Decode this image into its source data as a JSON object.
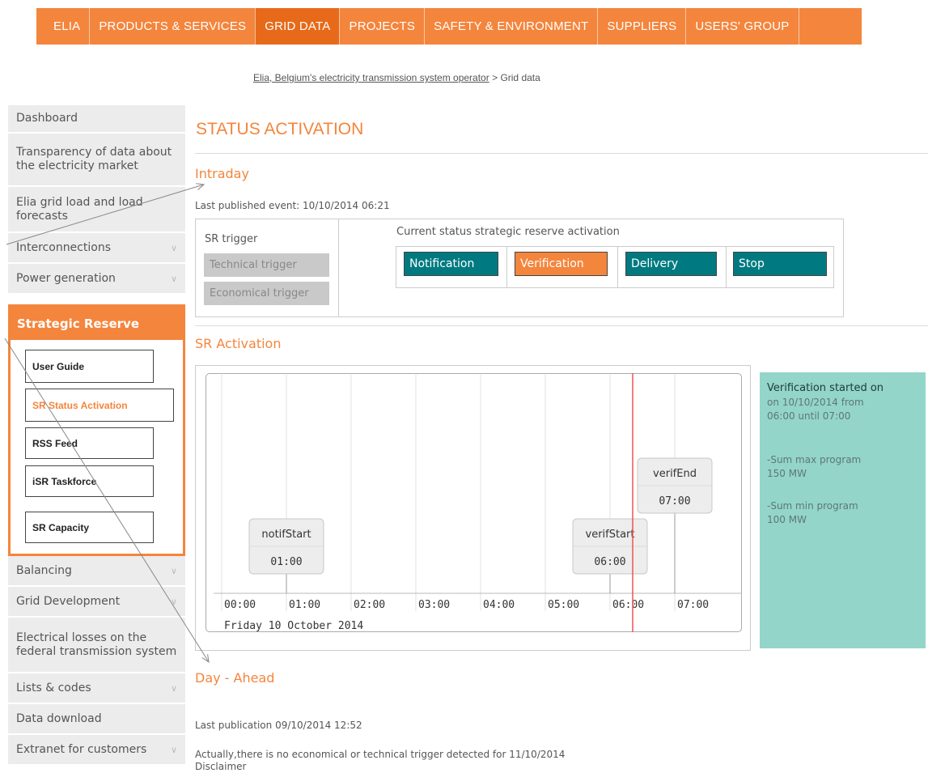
{
  "topnav": [
    "ELIA",
    "PRODUCTS & SERVICES",
    "GRID DATA",
    "PROJECTS",
    "SAFETY & ENVIRONMENT",
    "SUPPLIERS",
    "USERS' GROUP"
  ],
  "breadcrumb": {
    "link": "Elia, Belgium's electricity transmission system operator",
    "sep": ">",
    "current": "Grid data"
  },
  "sidebar": {
    "dashboard": "Dashboard",
    "transparency": "Transparency of data about the electricity market",
    "gridload": "Elia grid load and load forecasts",
    "interconnections": "Interconnections",
    "powergen": "Power generation",
    "strategic_reserve": "Strategic Reserve",
    "sr_items": [
      "User Guide",
      "SR Status Activation",
      "RSS Feed",
      "iSR Taskforce",
      "SR Capacity"
    ],
    "balancing": "Balancing",
    "griddev": "Grid Development",
    "losses": "Electrical losses on the federal transmission system",
    "lists": "Lists & codes",
    "download": "Data download",
    "extranet": "Extranet for customers"
  },
  "main": {
    "title": "STATUS ACTIVATION",
    "intraday": "Intraday",
    "last_event": "Last published event: 10/10/2014 06:21",
    "sr_trigger": "SR trigger",
    "technical": "Technical trigger",
    "economical": "Economical trigger",
    "current_status": "Current status strategic reserve activation",
    "statuses": [
      "Notification",
      "Verification",
      "Delivery",
      "Stop"
    ],
    "sr_activation": "SR Activation",
    "day_ahead": "Day - Ahead",
    "last_publication": "Last publication 09/10/2014 12:52",
    "no_trigger": "Actually,there is no economical or technical trigger detected for 11/10/2014",
    "disclaimer": "Disclaimer"
  },
  "info": {
    "head": "Verification started on",
    "line1": "on 10/10/2014 from",
    "line2": "06:00 until 07:00",
    "max_label": "-Sum max program",
    "max_val": "150 MW",
    "min_label": "-Sum min program",
    "min_val": "100 MW"
  },
  "chart_data": {
    "type": "timeline",
    "x_ticks": [
      "00:00",
      "01:00",
      "02:00",
      "03:00",
      "04:00",
      "05:00",
      "06:00",
      "07:00"
    ],
    "date_label": "Friday 10 October 2014",
    "current_time": "06:21",
    "events": [
      {
        "name": "notifStart",
        "time": "01:00"
      },
      {
        "name": "verifStart",
        "time": "06:00"
      },
      {
        "name": "verifEnd",
        "time": "07:00"
      }
    ]
  }
}
